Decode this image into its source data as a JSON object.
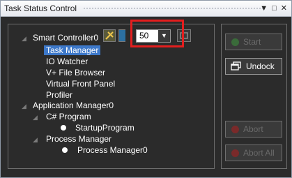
{
  "window": {
    "title": "Task Status Control",
    "buttons": [
      "▼",
      "□",
      "✕"
    ]
  },
  "tree": {
    "controller": "Smart Controller0",
    "interval_value": "50",
    "controller_children": [
      "Task Manager",
      "IO Watcher",
      "V+ File Browser",
      "Virtual Front Panel",
      "Profiler"
    ],
    "application_manager": "Application Manager0",
    "csharp_program": "C# Program",
    "startup_program": "StartupProgram",
    "process_manager": "Process Manager",
    "process_manager_child": "Process Manager0"
  },
  "actions": {
    "start": "Start",
    "undock": "Undock",
    "abort": "Abort",
    "abort_all": "Abort All"
  },
  "colors": {
    "start_dot": "#3a6b3a",
    "abort_dot": "#7a2a2a",
    "highlight": "#e41e1e",
    "selection": "#3d78c9"
  }
}
